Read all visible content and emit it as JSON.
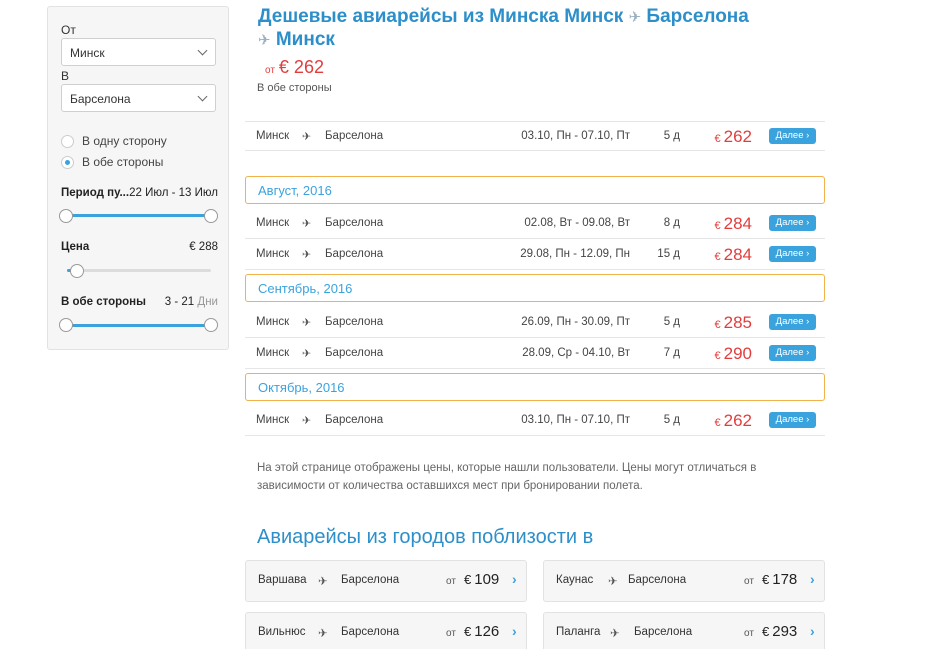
{
  "sidebar": {
    "from_label": "От",
    "from_value": "Минск",
    "to_label": "В",
    "to_value": "Барселона",
    "trip_types": [
      {
        "label": "В одну сторону",
        "checked": false
      },
      {
        "label": "В обе стороны",
        "checked": true
      }
    ],
    "period": {
      "title": "Период пу...",
      "value": "22 Июл - 13 Июл"
    },
    "price": {
      "title": "Цена",
      "value": "€ 288"
    },
    "duration": {
      "title": "В обе стороны",
      "value": "3 - 21",
      "unit": "Дни"
    }
  },
  "header": {
    "title_part1": "Дешевые авиарейсы из Минска Минск",
    "title_part2": "Барселона",
    "title_part3": "Минск",
    "plane_icon": "✈",
    "price_prefix": "от",
    "price": "€ 262",
    "trip_type": "В обе стороны"
  },
  "route_icon": "✈",
  "next_label": "Далее",
  "next_chevron": "›",
  "rows": [
    {
      "from": "Минск",
      "to": "Барселона",
      "dates": "03.10, Пн - 07.10, Пт",
      "days": "5 д",
      "currency": "€",
      "price": "262"
    },
    {
      "from": "Минск",
      "to": "Барселона",
      "dates": "02.08, Вт - 09.08, Вт",
      "days": "8 д",
      "currency": "€",
      "price": "284"
    },
    {
      "from": "Минск",
      "to": "Барселона",
      "dates": "29.08, Пн - 12.09, Пн",
      "days": "15 д",
      "currency": "€",
      "price": "284"
    },
    {
      "from": "Минск",
      "to": "Барселона",
      "dates": "26.09, Пн - 30.09, Пт",
      "days": "5 д",
      "currency": "€",
      "price": "285"
    },
    {
      "from": "Минск",
      "to": "Барселона",
      "dates": "28.09, Ср - 04.10, Вт",
      "days": "7 д",
      "currency": "€",
      "price": "290"
    },
    {
      "from": "Минск",
      "to": "Барселона",
      "dates": "03.10, Пн - 07.10, Пт",
      "days": "5 д",
      "currency": "€",
      "price": "262"
    }
  ],
  "months": [
    "Август, 2016",
    "Сентябрь, 2016",
    "Октябрь, 2016"
  ],
  "note": "На этой странице отображены цены, которые нашли пользователи. Цены могут отличаться в зависимости от количества оставшихся мест при бронировании полета.",
  "nearby": {
    "title": "Авиарейсы из городов поблизости в",
    "cards": [
      {
        "city": "Варшава",
        "to": "Барселона",
        "from_label": "от",
        "currency": "€",
        "price": "109"
      },
      {
        "city": "Каунас",
        "to": "Барселона",
        "from_label": "от",
        "currency": "€",
        "price": "178"
      },
      {
        "city": "Вильнюс",
        "to": "Барселона",
        "from_label": "от",
        "currency": "€",
        "price": "126"
      },
      {
        "city": "Паланга",
        "to": "Барселона",
        "from_label": "от",
        "currency": "€",
        "price": "293"
      }
    ],
    "chevron": "›"
  },
  "colors": {
    "accent": "#2d8fc9",
    "button": "#3aa3de",
    "price": "#e23d3d",
    "month_border": "#f0b24a"
  }
}
